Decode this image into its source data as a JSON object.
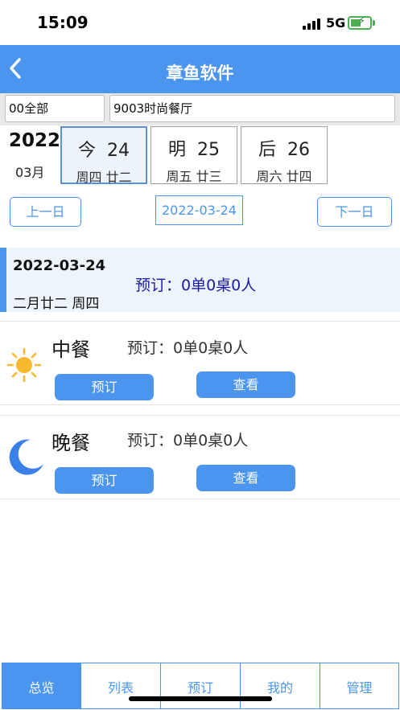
{
  "status": {
    "time": "15:09",
    "network": "5G"
  },
  "nav": {
    "title": "章鱼软件"
  },
  "filters": {
    "category": "00全部",
    "restaurant": "9003时尚餐厅"
  },
  "calendar": {
    "year": "2022",
    "month": "03月",
    "days": [
      {
        "label": "今",
        "day": "24",
        "sub": "周四 廿二",
        "selected": true
      },
      {
        "label": "明",
        "day": "25",
        "sub": "周五 廿三",
        "selected": false
      },
      {
        "label": "后",
        "day": "26",
        "sub": "周六 廿四",
        "selected": false
      }
    ]
  },
  "date_nav": {
    "prev_label": "上一日",
    "current_date": "2022-03-24",
    "next_label": "下一日"
  },
  "summary": {
    "date": "2022-03-24",
    "lunar": "二月廿二 周四",
    "booking": "预订：0单0桌0人"
  },
  "meals": [
    {
      "name": "中餐",
      "icon": "sun-icon",
      "booking": "预订：0单0桌0人",
      "reserve_label": "预订",
      "view_label": "查看"
    },
    {
      "name": "晚餐",
      "icon": "moon-icon",
      "booking": "预订：0单0桌0人",
      "reserve_label": "预订",
      "view_label": "查看"
    }
  ],
  "tabs": [
    {
      "label": "总览",
      "active": true
    },
    {
      "label": "列表",
      "active": false
    },
    {
      "label": "预订",
      "active": false
    },
    {
      "label": "我的",
      "active": false
    },
    {
      "label": "管理",
      "active": false
    }
  ],
  "colors": {
    "accent": "#4b95ee",
    "summary_bg": "#edf4fc",
    "booking_text": "#1a1aa6",
    "sun": "#f5b82e",
    "moon": "#3b7fe8"
  }
}
